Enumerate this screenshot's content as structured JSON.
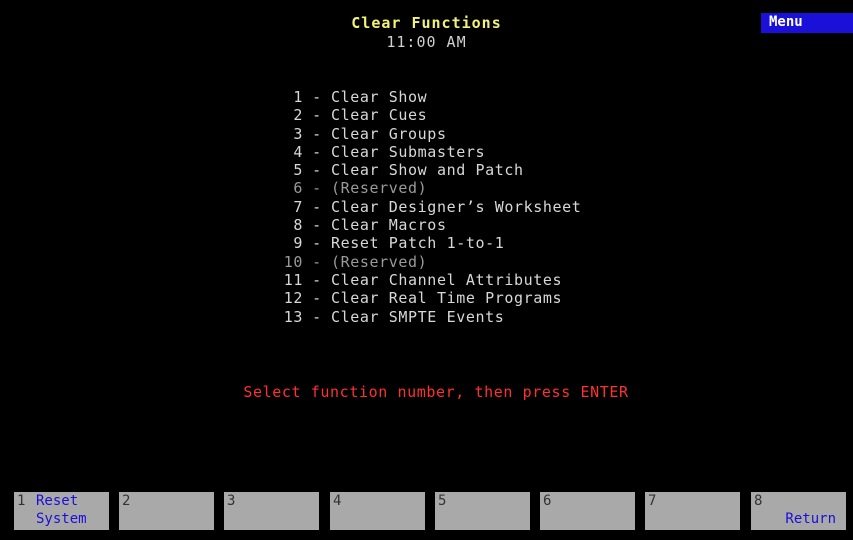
{
  "header": {
    "title": "Clear Functions",
    "time": "11:00 AM",
    "menu_label": "Menu"
  },
  "functions": [
    {
      "num": "1",
      "label": "Clear Show"
    },
    {
      "num": "2",
      "label": "Clear Cues"
    },
    {
      "num": "3",
      "label": "Clear Groups"
    },
    {
      "num": "4",
      "label": "Clear Submasters"
    },
    {
      "num": "5",
      "label": "Clear Show and Patch"
    },
    {
      "num": "6",
      "label": "(Reserved)"
    },
    {
      "num": "7",
      "label": "Clear Designer’s Worksheet"
    },
    {
      "num": "8",
      "label": "Clear Macros"
    },
    {
      "num": "9",
      "label": "Reset Patch 1-to-1"
    },
    {
      "num": "10",
      "label": "(Reserved)"
    },
    {
      "num": "11",
      "label": "Clear Channel Attributes"
    },
    {
      "num": "12",
      "label": "Clear Real Time Programs"
    },
    {
      "num": "13",
      "label": "Clear SMPTE Events"
    }
  ],
  "separator": "-",
  "prompt": "Select function number, then press ENTER",
  "softkeys": [
    {
      "num": "1",
      "line1": "Reset",
      "line2": "System"
    },
    {
      "num": "2",
      "line1": "",
      "line2": ""
    },
    {
      "num": "3",
      "line1": "",
      "line2": ""
    },
    {
      "num": "4",
      "line1": "",
      "line2": ""
    },
    {
      "num": "5",
      "line1": "",
      "line2": ""
    },
    {
      "num": "6",
      "line1": "",
      "line2": ""
    },
    {
      "num": "7",
      "line1": "",
      "line2": ""
    },
    {
      "num": "8",
      "line1": "",
      "line2": "Return"
    }
  ],
  "colors": {
    "background": "#000000",
    "title": "#f2f27a",
    "text": "#d8d8d8",
    "reserved": "#9a9a9a",
    "prompt": "#ff3030",
    "menu_bg": "#1a10d8",
    "softkey_bg": "#a9a9a9",
    "softkey_text": "#1a10d8"
  }
}
